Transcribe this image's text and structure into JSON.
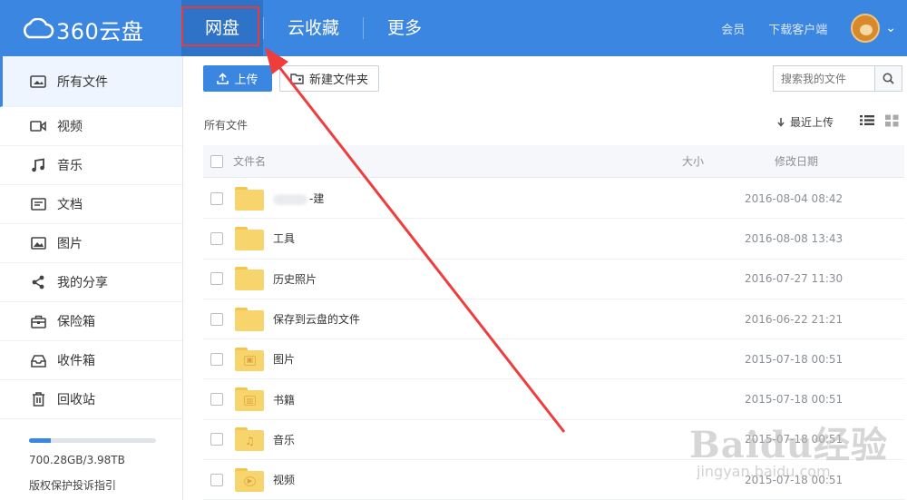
{
  "app": {
    "logo_text": "360云盘"
  },
  "nav": {
    "items": [
      {
        "label": "网盘",
        "active": true
      },
      {
        "label": "云收藏",
        "active": false
      },
      {
        "label": "更多",
        "active": false
      }
    ],
    "member": "会员",
    "download_client": "下载客户端"
  },
  "sidebar": {
    "items": [
      {
        "label": "所有文件",
        "icon": "all-files-icon",
        "active": true
      },
      {
        "label": "视频",
        "icon": "video-icon"
      },
      {
        "label": "音乐",
        "icon": "music-icon"
      },
      {
        "label": "文档",
        "icon": "document-icon"
      },
      {
        "label": "图片",
        "icon": "image-icon"
      },
      {
        "label": "我的分享",
        "icon": "share-icon"
      },
      {
        "label": "保险箱",
        "icon": "safe-box-icon"
      },
      {
        "label": "收件箱",
        "icon": "inbox-icon"
      },
      {
        "label": "回收站",
        "icon": "trash-icon"
      }
    ],
    "quota_text": "700.28GB/3.98TB",
    "quota_fraction": 0.17,
    "copyright_link": "版权保护投诉指引"
  },
  "toolbar": {
    "upload": "上传",
    "new_folder": "新建文件夹",
    "search_placeholder": "搜索我的文件"
  },
  "listing": {
    "breadcrumb": "所有文件",
    "sort_label": "最近上传",
    "columns": {
      "name": "文件名",
      "size": "大小",
      "date": "修改日期"
    },
    "rows": [
      {
        "name": "-建",
        "size": "",
        "date": "2016-08-04 08:42",
        "emblem": ""
      },
      {
        "name": "工具",
        "size": "",
        "date": "2016-08-08 13:43",
        "emblem": ""
      },
      {
        "name": "历史照片",
        "size": "",
        "date": "2016-07-27 11:30",
        "emblem": ""
      },
      {
        "name": "保存到云盘的文件",
        "size": "",
        "date": "2016-06-22 21:21",
        "emblem": ""
      },
      {
        "name": "图片",
        "size": "",
        "date": "2015-07-18 00:51",
        "emblem": "image"
      },
      {
        "name": "书籍",
        "size": "",
        "date": "2015-07-18 00:51",
        "emblem": "book"
      },
      {
        "name": "音乐",
        "size": "",
        "date": "2015-07-18 00:51",
        "emblem": "music"
      },
      {
        "name": "视频",
        "size": "",
        "date": "2015-07-18 00:51",
        "emblem": "video"
      }
    ]
  },
  "colors": {
    "brand": "#3b86e0",
    "annotation": "#e53b3b",
    "folder": "#f7d46c"
  },
  "watermark": {
    "main": "Baidu经验",
    "sub": "jingyan.baidu.com"
  }
}
